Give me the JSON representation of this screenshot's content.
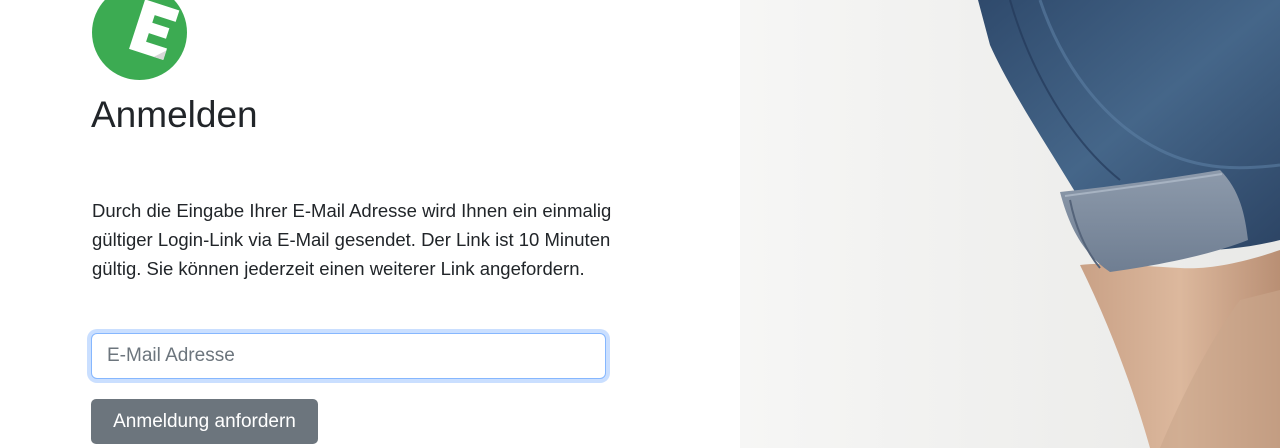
{
  "brand": {
    "logo_letter": "E",
    "logo_color": "#3cab52",
    "logo_letter_color": "#ffffff"
  },
  "login": {
    "title": "Anmelden",
    "description": "Durch die Eingabe Ihrer E-Mail Adresse wird Ihnen ein einmalig gültiger Login-Link via E-Mail gesendet. Der Link ist 10 Minuten gültig. Sie können jederzeit einen weiterer Link angefordern.",
    "email_placeholder": "E-Mail Adresse",
    "email_value": "",
    "submit_label": "Anmeldung anfordern"
  },
  "colors": {
    "button_bg": "#6c757d",
    "input_focus_border": "#86b7fe",
    "hero_background": "#f1f1ef",
    "denim": "#3c5a7e"
  }
}
